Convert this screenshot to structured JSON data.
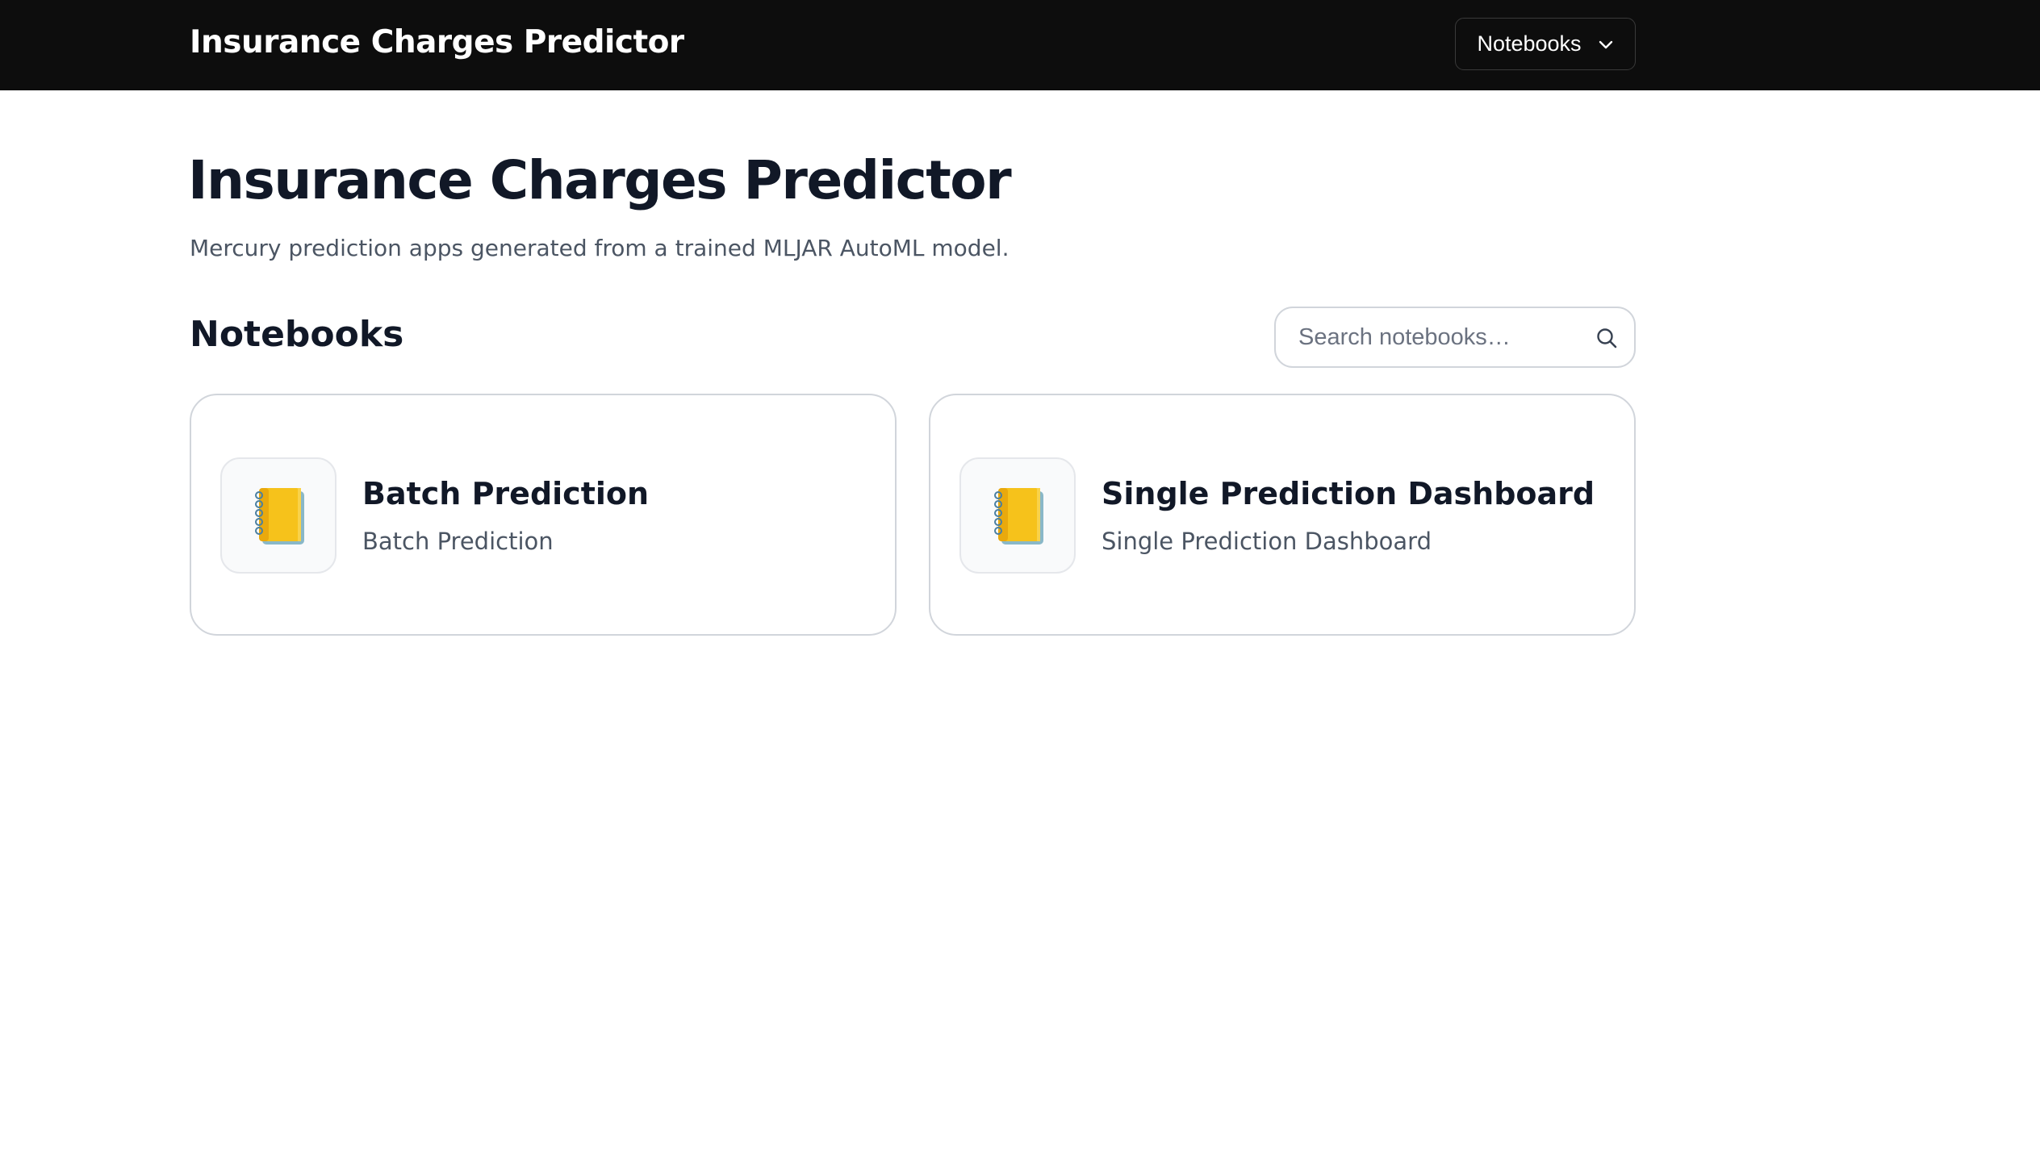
{
  "navbar": {
    "title": "Insurance Charges Predictor",
    "dropdown_label": "Notebooks",
    "dropdown_icon": "chevron-down-icon"
  },
  "header": {
    "title": "Insurance Charges Predictor",
    "subtitle": "Mercury prediction apps generated from a trained MLJAR AutoML model."
  },
  "notebooks_section": {
    "title": "Notebooks",
    "search": {
      "placeholder": "Search notebooks…",
      "value": "",
      "icon": "search-icon"
    },
    "cards": [
      {
        "title": "Batch Prediction",
        "description": "Batch Prediction",
        "icon": "notebook-icon"
      },
      {
        "title": "Single Prediction Dashboard",
        "description": "Single Prediction Dashboard",
        "icon": "notebook-icon"
      }
    ]
  },
  "colors": {
    "navbar_bg": "#0d0d0d",
    "text_primary": "#111827",
    "text_secondary": "#4b5563",
    "border": "#d1d5db",
    "notebook_icon": "#f6c21b"
  }
}
